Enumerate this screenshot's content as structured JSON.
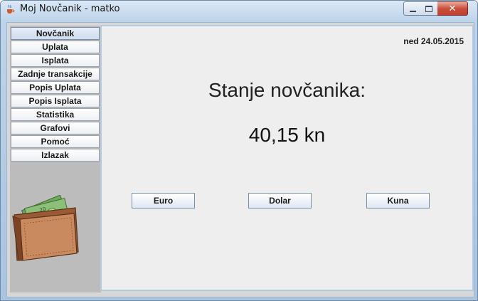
{
  "window": {
    "title": "Moj Novčanik - matko",
    "controls": {
      "minimize": "minimize-icon",
      "maximize": "maximize-icon",
      "close": "close-icon"
    }
  },
  "sidebar": {
    "items": [
      {
        "label": "Novčanik",
        "active": true
      },
      {
        "label": "Uplata"
      },
      {
        "label": "Isplata"
      },
      {
        "label": "Zadnje transakcije"
      },
      {
        "label": "Popis Uplata"
      },
      {
        "label": "Popis Isplata"
      },
      {
        "label": "Statistika"
      },
      {
        "label": "Grafovi"
      },
      {
        "label": "Pomoć"
      },
      {
        "label": "Izlazak"
      }
    ],
    "wallet_icon": "wallet-icon",
    "banknote_denomination": "20"
  },
  "main": {
    "date": "ned 24.05.2015",
    "heading": "Stanje novčanika:",
    "balance": "40,15 kn",
    "currency_buttons": {
      "euro": "Euro",
      "dolar": "Dolar",
      "kuna": "Kuna"
    }
  },
  "colors": {
    "titlebar": "#c1d6ec",
    "close_button": "#c94f3c",
    "panel_bg": "#eeeeee",
    "sidebar_bg": "#bcbcbc",
    "wallet_brown": "#b8764e",
    "banknote_green": "#7fb86a"
  }
}
